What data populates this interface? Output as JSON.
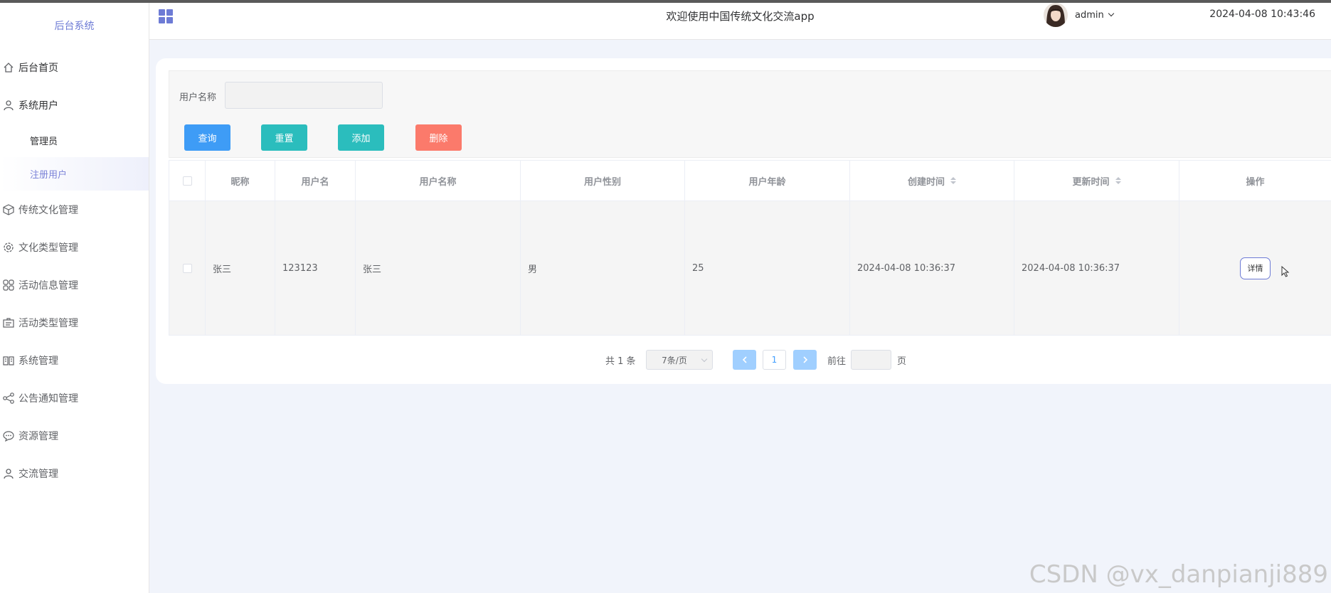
{
  "sidebar": {
    "brand": "后台系统",
    "items": [
      {
        "label": "后台首页",
        "icon": "home-icon"
      },
      {
        "label": "系统用户",
        "icon": "user-icon"
      },
      {
        "label": "管理员",
        "sub": true
      },
      {
        "label": "注册用户",
        "sub": true,
        "active": true
      },
      {
        "label": "传统文化管理",
        "icon": "box-icon"
      },
      {
        "label": "文化类型管理",
        "icon": "gear-icon"
      },
      {
        "label": "活动信息管理",
        "icon": "grid-icon"
      },
      {
        "label": "活动类型管理",
        "icon": "briefcase-icon"
      },
      {
        "label": "系统管理",
        "icon": "book-icon"
      },
      {
        "label": "公告通知管理",
        "icon": "share-icon"
      },
      {
        "label": "资源管理",
        "icon": "chat-icon"
      },
      {
        "label": "交流管理",
        "icon": "user-icon"
      }
    ]
  },
  "header": {
    "title": "欢迎使用中国传统文化交流app",
    "user": "admin",
    "datetime": "2024-04-08 10:43:46"
  },
  "filter": {
    "label": "用户名称",
    "input_value": "",
    "buttons": {
      "query": "查询",
      "reset": "重置",
      "add": "添加",
      "delete": "删除"
    }
  },
  "table": {
    "headers": [
      "昵称",
      "用户名",
      "用户名称",
      "用户性别",
      "用户年龄",
      "创建时间",
      "更新时间",
      "操作"
    ],
    "rows": [
      {
        "nickname": "张三",
        "username": "123123",
        "name": "张三",
        "gender": "男",
        "age": "25",
        "created": "2024-04-08 10:36:37",
        "updated": "2024-04-08 10:36:37",
        "action": "详情"
      }
    ]
  },
  "pager": {
    "total": "共 1 条",
    "page_size": "7条/页",
    "current": "1",
    "goto_prefix": "前往",
    "goto_suffix": "页"
  },
  "watermark": "CSDN @vx_danpianji889",
  "colors": {
    "accent": "#6d7bd5",
    "blue": "#3e9cf6",
    "teal": "#2bbdbd",
    "red": "#fb7a6b"
  }
}
